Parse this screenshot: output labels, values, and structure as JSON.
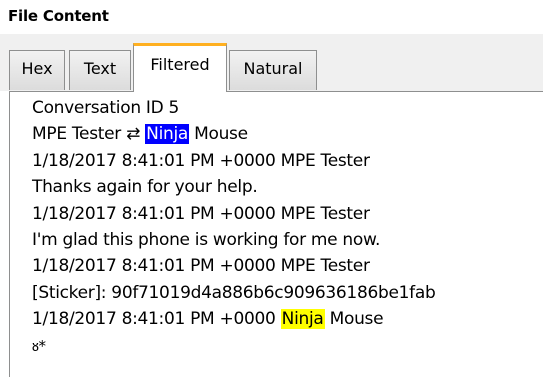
{
  "panel": {
    "title": "File Content"
  },
  "tabs": [
    {
      "label": "Hex",
      "active": false
    },
    {
      "label": "Text",
      "active": false
    },
    {
      "label": "Filtered",
      "active": true
    },
    {
      "label": "Natural",
      "active": false
    }
  ],
  "content": {
    "line1": "Conversation ID 5",
    "line2_a": "MPE Tester ⇄ ",
    "line2_hl": "Ninja",
    "line2_b": " Mouse",
    "line3": "1/18/2017 8:41:01 PM +0000 MPE Tester",
    "line4": "Thanks again for your help.",
    "line5": "1/18/2017 8:41:01 PM +0000 MPE Tester",
    "line6": "I'm glad this phone is working for me now.",
    "line7": "1/18/2017 8:41:01 PM +0000 MPE Tester",
    "line8": "[Sticker]: 90f71019d4a886b6c909636186be1fab",
    "line9_a": "1/18/2017 8:41:01 PM +0000 ",
    "line9_hl": "Ninja",
    "line9_b": " Mouse",
    "line10": "ᴕ*"
  },
  "colors": {
    "selection_highlight": "#0000ff",
    "search_highlight": "#ffff00",
    "active_tab_accent": "#ffb020",
    "tab_border": "#8e8f8f"
  }
}
